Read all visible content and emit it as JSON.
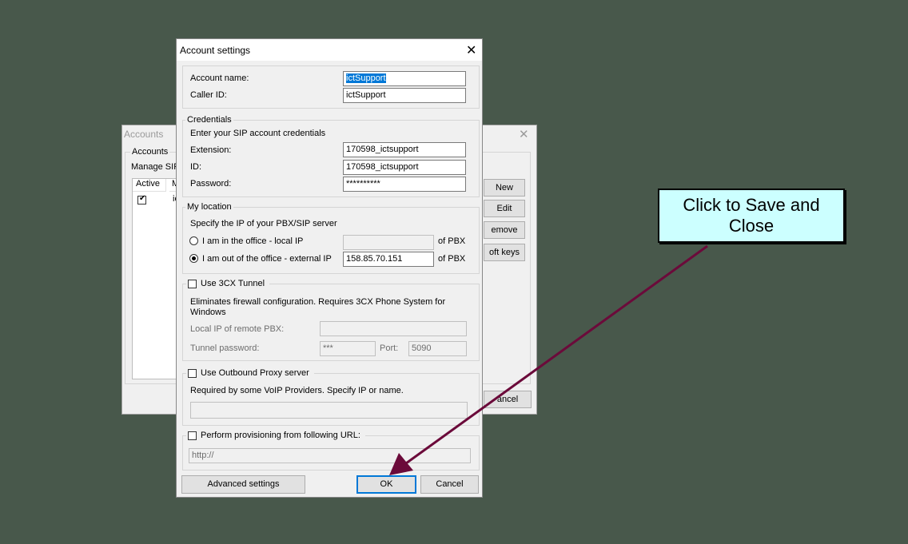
{
  "background_window": {
    "title": "Accounts",
    "group_label": "Accounts",
    "manage_text": "Manage SIP",
    "col_active": "Active",
    "col_m": "M",
    "row_partial": "ic",
    "buttons": {
      "new": "New",
      "edit": "Edit",
      "remove": "emove",
      "soft_keys": "oft keys",
      "cancel": "ancel"
    }
  },
  "dialog": {
    "title": "Account settings",
    "account": {
      "name_label": "Account name:",
      "name_value": "ictSupport",
      "caller_label": "Caller ID:",
      "caller_value": "ictSupport"
    },
    "credentials": {
      "legend": "Credentials",
      "hint": "Enter your SIP account credentials",
      "extension_label": "Extension:",
      "extension_value": "170598_ictsupport",
      "id_label": "ID:",
      "id_value": "170598_ictsupport",
      "password_label": "Password:",
      "password_value": "**********"
    },
    "location": {
      "legend": "My location",
      "hint": "Specify the IP of your PBX/SIP server",
      "local_label": "I am in the office - local IP",
      "local_value": "",
      "local_suffix": "of PBX",
      "external_label": "I am out of the office - external IP",
      "external_value": "158.85.70.151",
      "external_suffix": "of PBX",
      "selected": "external"
    },
    "tunnel": {
      "legend": "Use 3CX Tunnel",
      "checked": false,
      "desc": "Eliminates firewall configuration. Requires 3CX Phone System for Windows",
      "local_ip_label": "Local IP of remote PBX:",
      "local_ip_value": "",
      "password_label": "Tunnel password:",
      "password_value": "***",
      "port_label": "Port:",
      "port_value": "5090"
    },
    "proxy": {
      "legend": "Use Outbound Proxy server",
      "checked": false,
      "desc": "Required by some VoIP Providers. Specify IP or name.",
      "value": ""
    },
    "provisioning": {
      "legend": "Perform provisioning from following URL:",
      "checked": false,
      "url_value": "http://"
    },
    "buttons": {
      "advanced": "Advanced settings",
      "ok": "OK",
      "cancel": "Cancel"
    }
  },
  "annotation": {
    "callout_text": "Click to Save and Close",
    "arrow_color": "#6b0a3a",
    "callout_bg": "#ccffff"
  }
}
